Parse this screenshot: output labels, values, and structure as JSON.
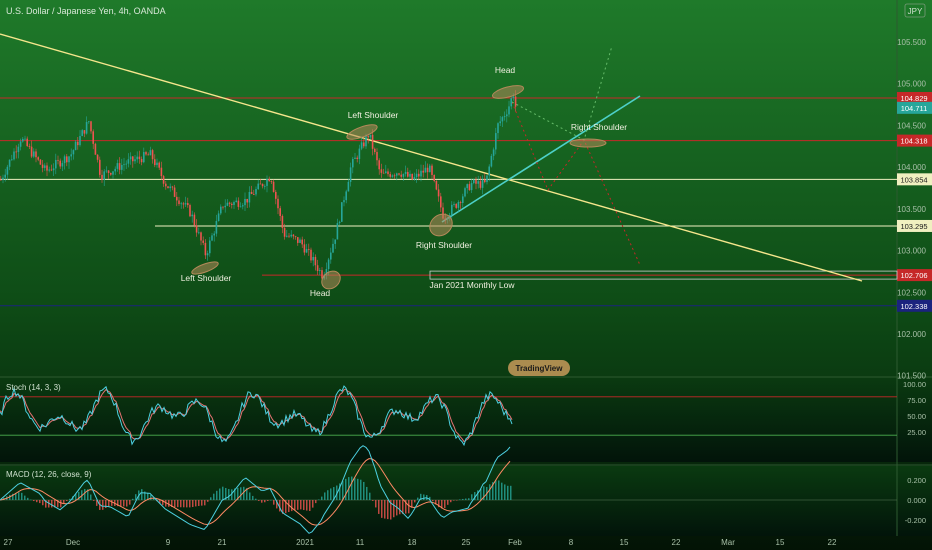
{
  "header": {
    "symbol_title": "U.S. Dollar / Japanese Yen, 4h, OANDA",
    "currency_badge": "JPY"
  },
  "chart_data": {
    "type": "candlestick",
    "price_ticks": [
      "105.500",
      "105.000",
      "104.500",
      "104.000",
      "103.500",
      "103.000",
      "102.500",
      "102.000",
      "101.500"
    ],
    "levels": [
      {
        "value": 104.829,
        "label": "104.829",
        "color": "#c62828",
        "scope": "full"
      },
      {
        "value": 104.318,
        "label": "104.318",
        "color": "#c62828",
        "scope": "full"
      },
      {
        "value": 103.854,
        "label": "103.854",
        "color": "#f0f0c0",
        "scope": "full"
      },
      {
        "value": 103.295,
        "label": "103.295",
        "color": "#f0f0c0",
        "scope": "partial"
      },
      {
        "value": 102.706,
        "label": "102.706",
        "color": "#c62828",
        "scope": "partial"
      },
      {
        "value": 102.338,
        "label": "102.338",
        "color": "#1a237e",
        "scope": "full"
      }
    ],
    "last_price": {
      "value": 104.711,
      "label": "104.711",
      "color": "#26a69a"
    },
    "annotations": [
      {
        "text": "Left Shoulder",
        "at": 102.95,
        "near": "left-low"
      },
      {
        "text": "Head",
        "at": 102.6,
        "near": "center-low"
      },
      {
        "text": "Right Shoulder",
        "at": 103.25,
        "near": "mid-low"
      },
      {
        "text": "Left Shoulder",
        "at": 104.35,
        "near": "mid-high"
      },
      {
        "text": "Head",
        "at": 104.85,
        "near": "right-high"
      },
      {
        "text": "Right Shoulder",
        "at": 104.4,
        "near": "right-projection"
      },
      {
        "text": "Jan 2021 Monthly Low",
        "at": 102.706,
        "near": "box"
      }
    ],
    "stoch": {
      "title": "Stoch (14, 3, 3)",
      "ticks": [
        "100.00",
        "75.00",
        "50.00",
        "25.00"
      ],
      "levels": [
        80,
        20
      ]
    },
    "macd": {
      "title": "MACD (12, 26, close, 9)",
      "ticks": [
        "0.400",
        "0.200",
        "0.000",
        "-0.200"
      ]
    },
    "x_ticks": [
      "27",
      "Dec",
      "9",
      "21",
      "2021",
      "11",
      "18",
      "25",
      "Feb",
      "8",
      "15",
      "22",
      "Mar",
      "15",
      "22"
    ],
    "logo_text": "TradingView"
  },
  "colors": {
    "bull": "#26a69a",
    "bear": "#ef5350",
    "trendline": "#f5e68c",
    "neckline_up": "#4dd0c8",
    "projection": "#c62828",
    "projection_up": "#66bb6a",
    "ellipse": "#b5895a"
  }
}
